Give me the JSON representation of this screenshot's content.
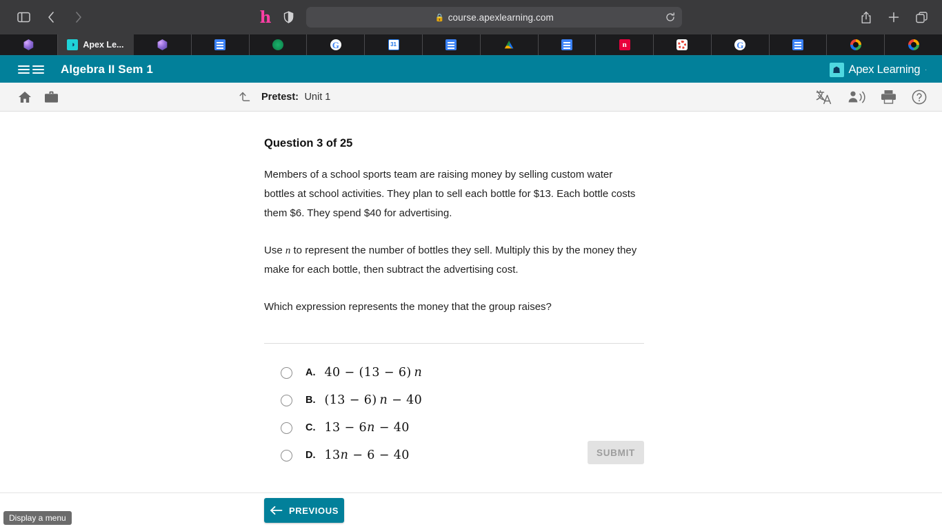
{
  "browser": {
    "back_icon": "chevron-left-icon",
    "forward_icon": "chevron-right-icon",
    "sidebar_icon": "sidebar-toggle-icon",
    "honey_icon": "honey-extension-icon",
    "shield_icon": "privacy-shield-icon",
    "url": "course.apexlearning.com",
    "lock_glyph": "🔒",
    "reload_icon": "reload-icon",
    "share_icon": "share-icon",
    "new_tab_icon": "plus-icon",
    "tab_overview_icon": "tab-overview-icon",
    "tabs": [
      {
        "label": "",
        "favicon": "hex-icon"
      },
      {
        "label": "Apex Le...",
        "favicon": "apex-learning-icon",
        "active": true
      },
      {
        "label": "",
        "favicon": "hex-icon"
      },
      {
        "label": "",
        "favicon": "google-docs-icon"
      },
      {
        "label": "",
        "favicon": "green-circle-icon"
      },
      {
        "label": "",
        "favicon": "google-icon"
      },
      {
        "label": "",
        "favicon": "google-calendar-icon"
      },
      {
        "label": "",
        "favicon": "google-docs-icon"
      },
      {
        "label": "",
        "favicon": "google-drive-icon"
      },
      {
        "label": "",
        "favicon": "google-docs-icon"
      },
      {
        "label": "",
        "favicon": "pink-n-icon"
      },
      {
        "label": "",
        "favicon": "red-dotted-circle-icon"
      },
      {
        "label": "",
        "favicon": "google-icon"
      },
      {
        "label": "",
        "favicon": "google-docs-icon"
      },
      {
        "label": "",
        "favicon": "color-ring-icon"
      },
      {
        "label": "",
        "favicon": "color-ring-icon"
      }
    ]
  },
  "app_header": {
    "menu_icon": "hamburger-menu-icon",
    "course_title": "Algebra II Sem 1",
    "brand_name": "Apex Learning",
    "brand_tm": "·",
    "brand_icon": "apex-learning-logo-icon",
    "accent_color": "#02809a"
  },
  "sub_toolbar": {
    "home_icon": "home-icon",
    "briefcase_icon": "briefcase-icon",
    "upload_icon": "upload-arrow-icon",
    "pretest_label": "Pretest:",
    "pretest_value": "Unit 1",
    "translate_icon": "translate-icon",
    "read_aloud_icon": "read-aloud-icon",
    "print_icon": "print-icon",
    "help_icon": "help-circle-icon"
  },
  "question": {
    "title": "Question 3 of 25",
    "paragraph_1": "Members of a school sports team are raising money by selling custom water bottles at school activities. They plan to sell each bottle for $13. Each bottle costs them $6. They spend $40 for advertising.",
    "paragraph_2_a": "Use ",
    "paragraph_2_var": "n",
    "paragraph_2_b": " to represent the number of bottles they sell. Multiply this by the money they make for each bottle, then subtract the advertising cost.",
    "paragraph_3": "Which expression represents the money that the group raises?",
    "choices": [
      {
        "letter": "A.",
        "pre": "40 − (13 − 6) ",
        "var": "n",
        "post": ""
      },
      {
        "letter": "B.",
        "pre": "(13 − 6) ",
        "var": "n",
        "post": " − 40"
      },
      {
        "letter": "C.",
        "pre": "13 − 6",
        "var": "n",
        "post": " − 40"
      },
      {
        "letter": "D.",
        "pre": "13",
        "var": "n",
        "post": " − 6 − 40"
      }
    ]
  },
  "actions": {
    "submit_label": "SUBMIT",
    "previous_label": "PREVIOUS",
    "previous_arrow_icon": "arrow-left-icon"
  },
  "tooltip": {
    "text": "Display a menu"
  }
}
